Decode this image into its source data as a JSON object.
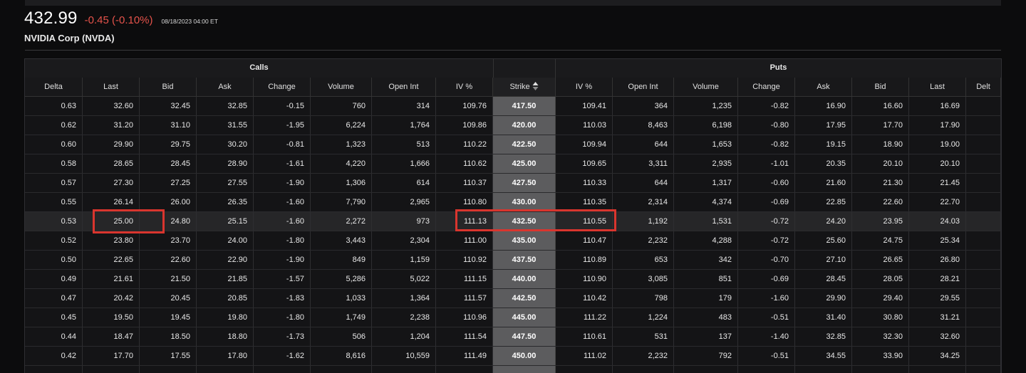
{
  "quote": {
    "price": "432.99",
    "change": "-0.45",
    "change_pct": "(-0.10%)",
    "timestamp": "08/18/2023 04:00 ET",
    "company": "NVIDIA Corp (NVDA)"
  },
  "groups": {
    "calls": "Calls",
    "puts": "Puts"
  },
  "columns": [
    "Delta",
    "Last",
    "Bid",
    "Ask",
    "Change",
    "Volume",
    "Open Int",
    "IV %",
    "Strike",
    "IV %",
    "Open Int",
    "Volume",
    "Change",
    "Ask",
    "Bid",
    "Last",
    "Delt"
  ],
  "sort_icon": "sort-up-down-icon",
  "colors": {
    "negative": "#e5534b",
    "highlight_box": "#d9352e",
    "strike_bg": "#5c5c5e"
  },
  "rows": [
    [
      "0.63",
      "32.60",
      "32.45",
      "32.85",
      "-0.15",
      "760",
      "314",
      "109.76",
      "417.50",
      "109.41",
      "364",
      "1,235",
      "-0.82",
      "16.90",
      "16.60",
      "16.69",
      ""
    ],
    [
      "0.62",
      "31.20",
      "31.10",
      "31.55",
      "-1.95",
      "6,224",
      "1,764",
      "109.86",
      "420.00",
      "110.03",
      "8,463",
      "6,198",
      "-0.80",
      "17.95",
      "17.70",
      "17.90",
      ""
    ],
    [
      "0.60",
      "29.90",
      "29.75",
      "30.20",
      "-0.81",
      "1,323",
      "513",
      "110.22",
      "422.50",
      "109.94",
      "644",
      "1,653",
      "-0.82",
      "19.15",
      "18.90",
      "19.00",
      ""
    ],
    [
      "0.58",
      "28.65",
      "28.45",
      "28.90",
      "-1.61",
      "4,220",
      "1,666",
      "110.62",
      "425.00",
      "109.65",
      "3,311",
      "2,935",
      "-1.01",
      "20.35",
      "20.10",
      "20.10",
      ""
    ],
    [
      "0.57",
      "27.30",
      "27.25",
      "27.55",
      "-1.90",
      "1,306",
      "614",
      "110.37",
      "427.50",
      "110.33",
      "644",
      "1,317",
      "-0.60",
      "21.60",
      "21.30",
      "21.45",
      ""
    ],
    [
      "0.55",
      "26.14",
      "26.00",
      "26.35",
      "-1.60",
      "7,790",
      "2,965",
      "110.80",
      "430.00",
      "110.35",
      "2,314",
      "4,374",
      "-0.69",
      "22.85",
      "22.60",
      "22.70",
      ""
    ],
    [
      "0.53",
      "25.00",
      "24.80",
      "25.15",
      "-1.60",
      "2,272",
      "973",
      "111.13",
      "432.50",
      "110.55",
      "1,192",
      "1,531",
      "-0.72",
      "24.20",
      "23.95",
      "24.03",
      ""
    ],
    [
      "0.52",
      "23.80",
      "23.70",
      "24.00",
      "-1.80",
      "3,443",
      "2,304",
      "111.00",
      "435.00",
      "110.47",
      "2,232",
      "4,288",
      "-0.72",
      "25.60",
      "24.75",
      "25.34",
      ""
    ],
    [
      "0.50",
      "22.65",
      "22.60",
      "22.90",
      "-1.90",
      "849",
      "1,159",
      "110.92",
      "437.50",
      "110.89",
      "653",
      "342",
      "-0.70",
      "27.10",
      "26.65",
      "26.80",
      ""
    ],
    [
      "0.49",
      "21.61",
      "21.50",
      "21.85",
      "-1.57",
      "5,286",
      "5,022",
      "111.15",
      "440.00",
      "110.90",
      "3,085",
      "851",
      "-0.69",
      "28.45",
      "28.05",
      "28.21",
      ""
    ],
    [
      "0.47",
      "20.42",
      "20.45",
      "20.85",
      "-1.83",
      "1,033",
      "1,364",
      "111.57",
      "442.50",
      "110.42",
      "798",
      "179",
      "-1.60",
      "29.90",
      "29.40",
      "29.55",
      ""
    ],
    [
      "0.45",
      "19.50",
      "19.45",
      "19.80",
      "-1.80",
      "1,749",
      "2,238",
      "110.96",
      "445.00",
      "111.22",
      "1,224",
      "483",
      "-0.51",
      "31.40",
      "30.80",
      "31.21",
      ""
    ],
    [
      "0.44",
      "18.47",
      "18.50",
      "18.80",
      "-1.73",
      "506",
      "1,204",
      "111.54",
      "447.50",
      "110.61",
      "531",
      "137",
      "-1.40",
      "32.85",
      "32.30",
      "32.60",
      ""
    ],
    [
      "0.42",
      "17.70",
      "17.55",
      "17.80",
      "-1.62",
      "8,616",
      "10,559",
      "111.49",
      "450.00",
      "111.02",
      "2,232",
      "792",
      "-0.51",
      "34.55",
      "33.90",
      "34.25",
      ""
    ],
    [
      "",
      "",
      "",
      "",
      "",
      "",
      "",
      "",
      "",
      "",
      "",
      "",
      "",
      "",
      "",
      "",
      ""
    ]
  ]
}
